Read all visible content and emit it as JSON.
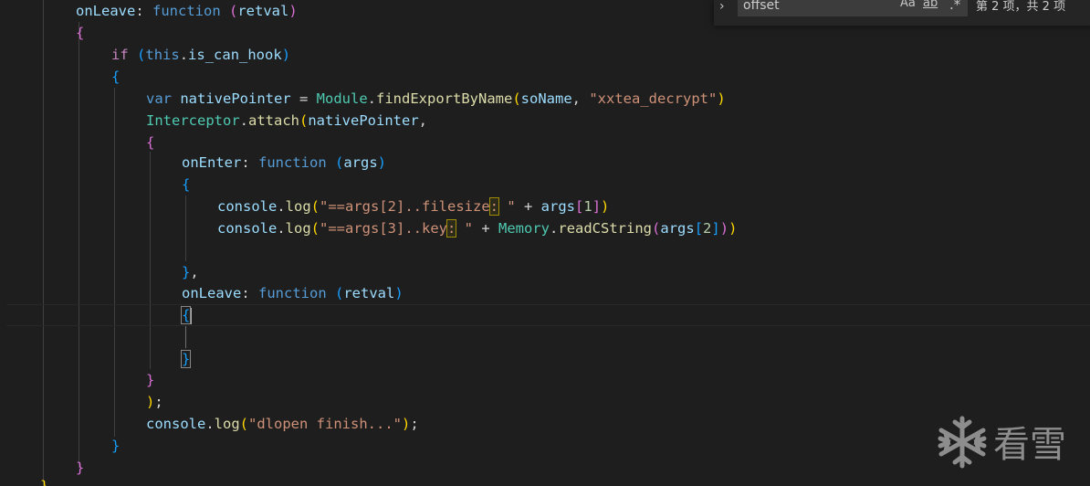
{
  "find": {
    "query": "offset",
    "match_case_label": "Aa",
    "whole_word_label": "ab",
    "regex_label": ".*",
    "match_count": "第 2 项，共 2 项"
  },
  "watermark": {
    "text": "看雪"
  },
  "code": {
    "l1": [
      "onLeave",
      ": ",
      "function",
      " ",
      "(",
      "retval",
      ")"
    ],
    "l2": [
      "{"
    ],
    "l3": [
      "if",
      " ",
      "(",
      "this",
      ".",
      "is_can_hook",
      ")"
    ],
    "l4": [
      "{"
    ],
    "l5": [
      "var",
      " ",
      "nativePointer",
      " = ",
      "Module",
      ".",
      "findExportByName",
      "(",
      "soName",
      ", ",
      "\"xxtea_decrypt\"",
      ")"
    ],
    "l6": [
      "Interceptor",
      ".",
      "attach",
      "(",
      "nativePointer",
      ","
    ],
    "l7": [
      "{"
    ],
    "l8": [
      "onEnter",
      ": ",
      "function",
      " ",
      "(",
      "args",
      ")"
    ],
    "l9": [
      "{"
    ],
    "l10": [
      "console",
      ".",
      "log",
      "(",
      "\"==args[2]..filesize",
      ":",
      " \"",
      " + ",
      "args",
      "[",
      "1",
      "]",
      ")"
    ],
    "l11": [
      "console",
      ".",
      "log",
      "(",
      "\"==args[3]..key",
      ":",
      " \"",
      " + ",
      "Memory",
      ".",
      "readCString",
      "(",
      "args",
      "[",
      "2",
      "]",
      ")",
      ")"
    ],
    "l13": [
      "}",
      ","
    ],
    "l14": [
      "onLeave",
      ": ",
      "function",
      " ",
      "(",
      "retval",
      ")"
    ],
    "l15": [
      "{"
    ],
    "l17": [
      "}"
    ],
    "l18": [
      "}"
    ],
    "l19": [
      ")",
      ";"
    ],
    "l20": [
      "console",
      ".",
      "log",
      "(",
      "\"dlopen finish...\"",
      ")",
      ";"
    ],
    "l21": [
      "}"
    ],
    "l22": [
      "}"
    ],
    "l23": [
      "}"
    ]
  }
}
